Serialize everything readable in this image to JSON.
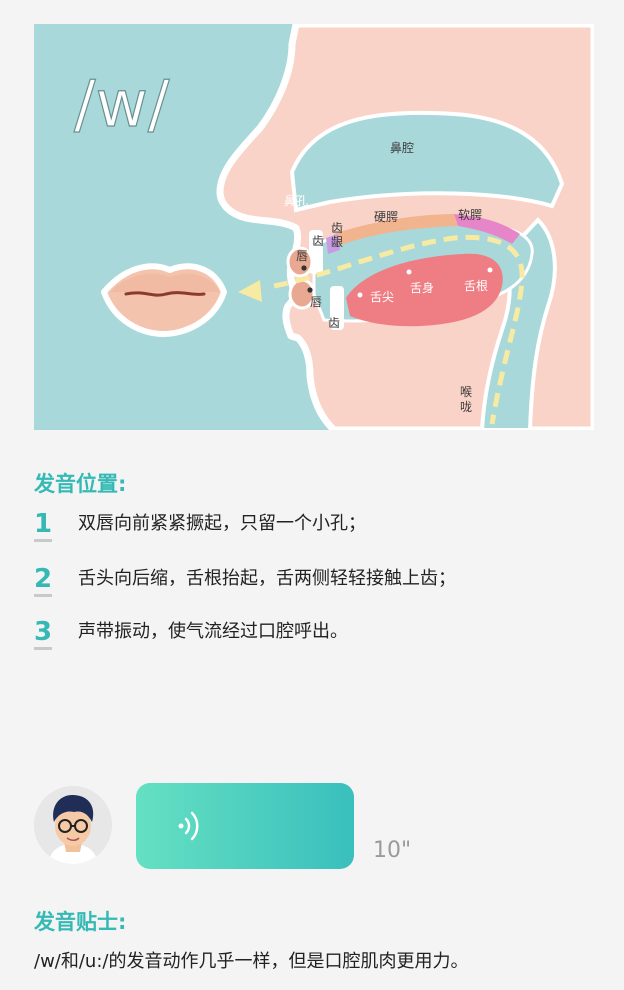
{
  "diagram": {
    "phoneme": "/w/",
    "labels": {
      "nasal_cavity": "鼻腔",
      "nostril": "鼻孔",
      "upper_teeth": "齿",
      "alveolar_line1": "齿",
      "alveolar_line2": "龈",
      "hard_palate": "硬腭",
      "soft_palate": "软腭",
      "upper_lip": "唇",
      "lower_lip": "唇",
      "lower_teeth": "齿",
      "tongue_tip": "舌尖",
      "tongue_body": "舌身",
      "tongue_root": "舌根",
      "throat_line1": "喉",
      "throat_line2": "咙"
    },
    "colors": {
      "background": "#a8d8d9",
      "face": "#f9d3c7",
      "outline": "#ffffff",
      "tongue": "#ee7e84",
      "hard_palate": "#f2b48f",
      "soft_palate": "#e785c9",
      "alveolar": "#c99be3",
      "airflow": "#f7eaa2"
    }
  },
  "position_section": {
    "title": "发音位置:",
    "steps": [
      {
        "num": "1",
        "text": "双唇向前紧紧撅起，只留一个小孔；"
      },
      {
        "num": "2",
        "text": "舌头向后缩，舌根抬起，舌两侧轻轻接触上齿；"
      },
      {
        "num": "3",
        "text": "声带振动，使气流经过口腔呼出。"
      }
    ]
  },
  "audio": {
    "duration": "10\"",
    "icon": "sound-wave-icon"
  },
  "tips_section": {
    "title": "发音贴士:",
    "text": "/w/和/u:/的发音动作几乎一样，但是口腔肌肉更用力。"
  }
}
